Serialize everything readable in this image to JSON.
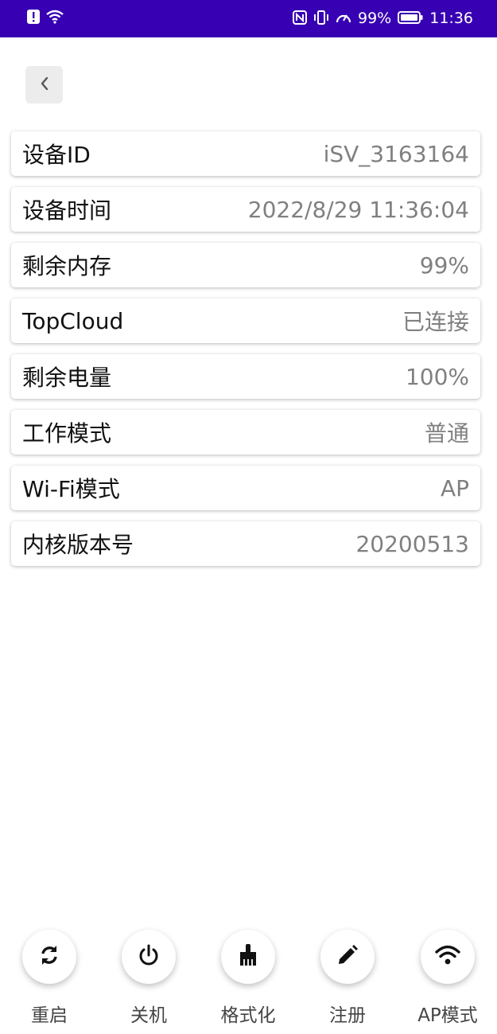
{
  "status_bar": {
    "battery_percent": "99%",
    "time": "11:36",
    "icons": [
      "alert-icon",
      "wifi-icon",
      "nfc-icon",
      "vibrate-icon",
      "speed-icon",
      "battery-icon"
    ]
  },
  "header": {
    "back_icon": "chevron-left-icon"
  },
  "info_rows": [
    {
      "label": "设备ID",
      "value": "iSV_3163164"
    },
    {
      "label": "设备时间",
      "value": "2022/8/29 11:36:04"
    },
    {
      "label": "剩余内存",
      "value": "99%"
    },
    {
      "label": "TopCloud",
      "value": "已连接"
    },
    {
      "label": "剩余电量",
      "value": "100%"
    },
    {
      "label": "工作模式",
      "value": "普通"
    },
    {
      "label": "Wi-Fi模式",
      "value": "AP"
    },
    {
      "label": "内核版本号",
      "value": "20200513"
    }
  ],
  "actions": [
    {
      "label": "重启",
      "icon": "refresh-icon"
    },
    {
      "label": "关机",
      "icon": "power-icon"
    },
    {
      "label": "格式化",
      "icon": "broom-icon"
    },
    {
      "label": "注册",
      "icon": "pencil-icon"
    },
    {
      "label": "AP模式",
      "icon": "wifi-icon"
    }
  ],
  "colors": {
    "status_bar": "#3700b3",
    "value_text": "#808080"
  }
}
